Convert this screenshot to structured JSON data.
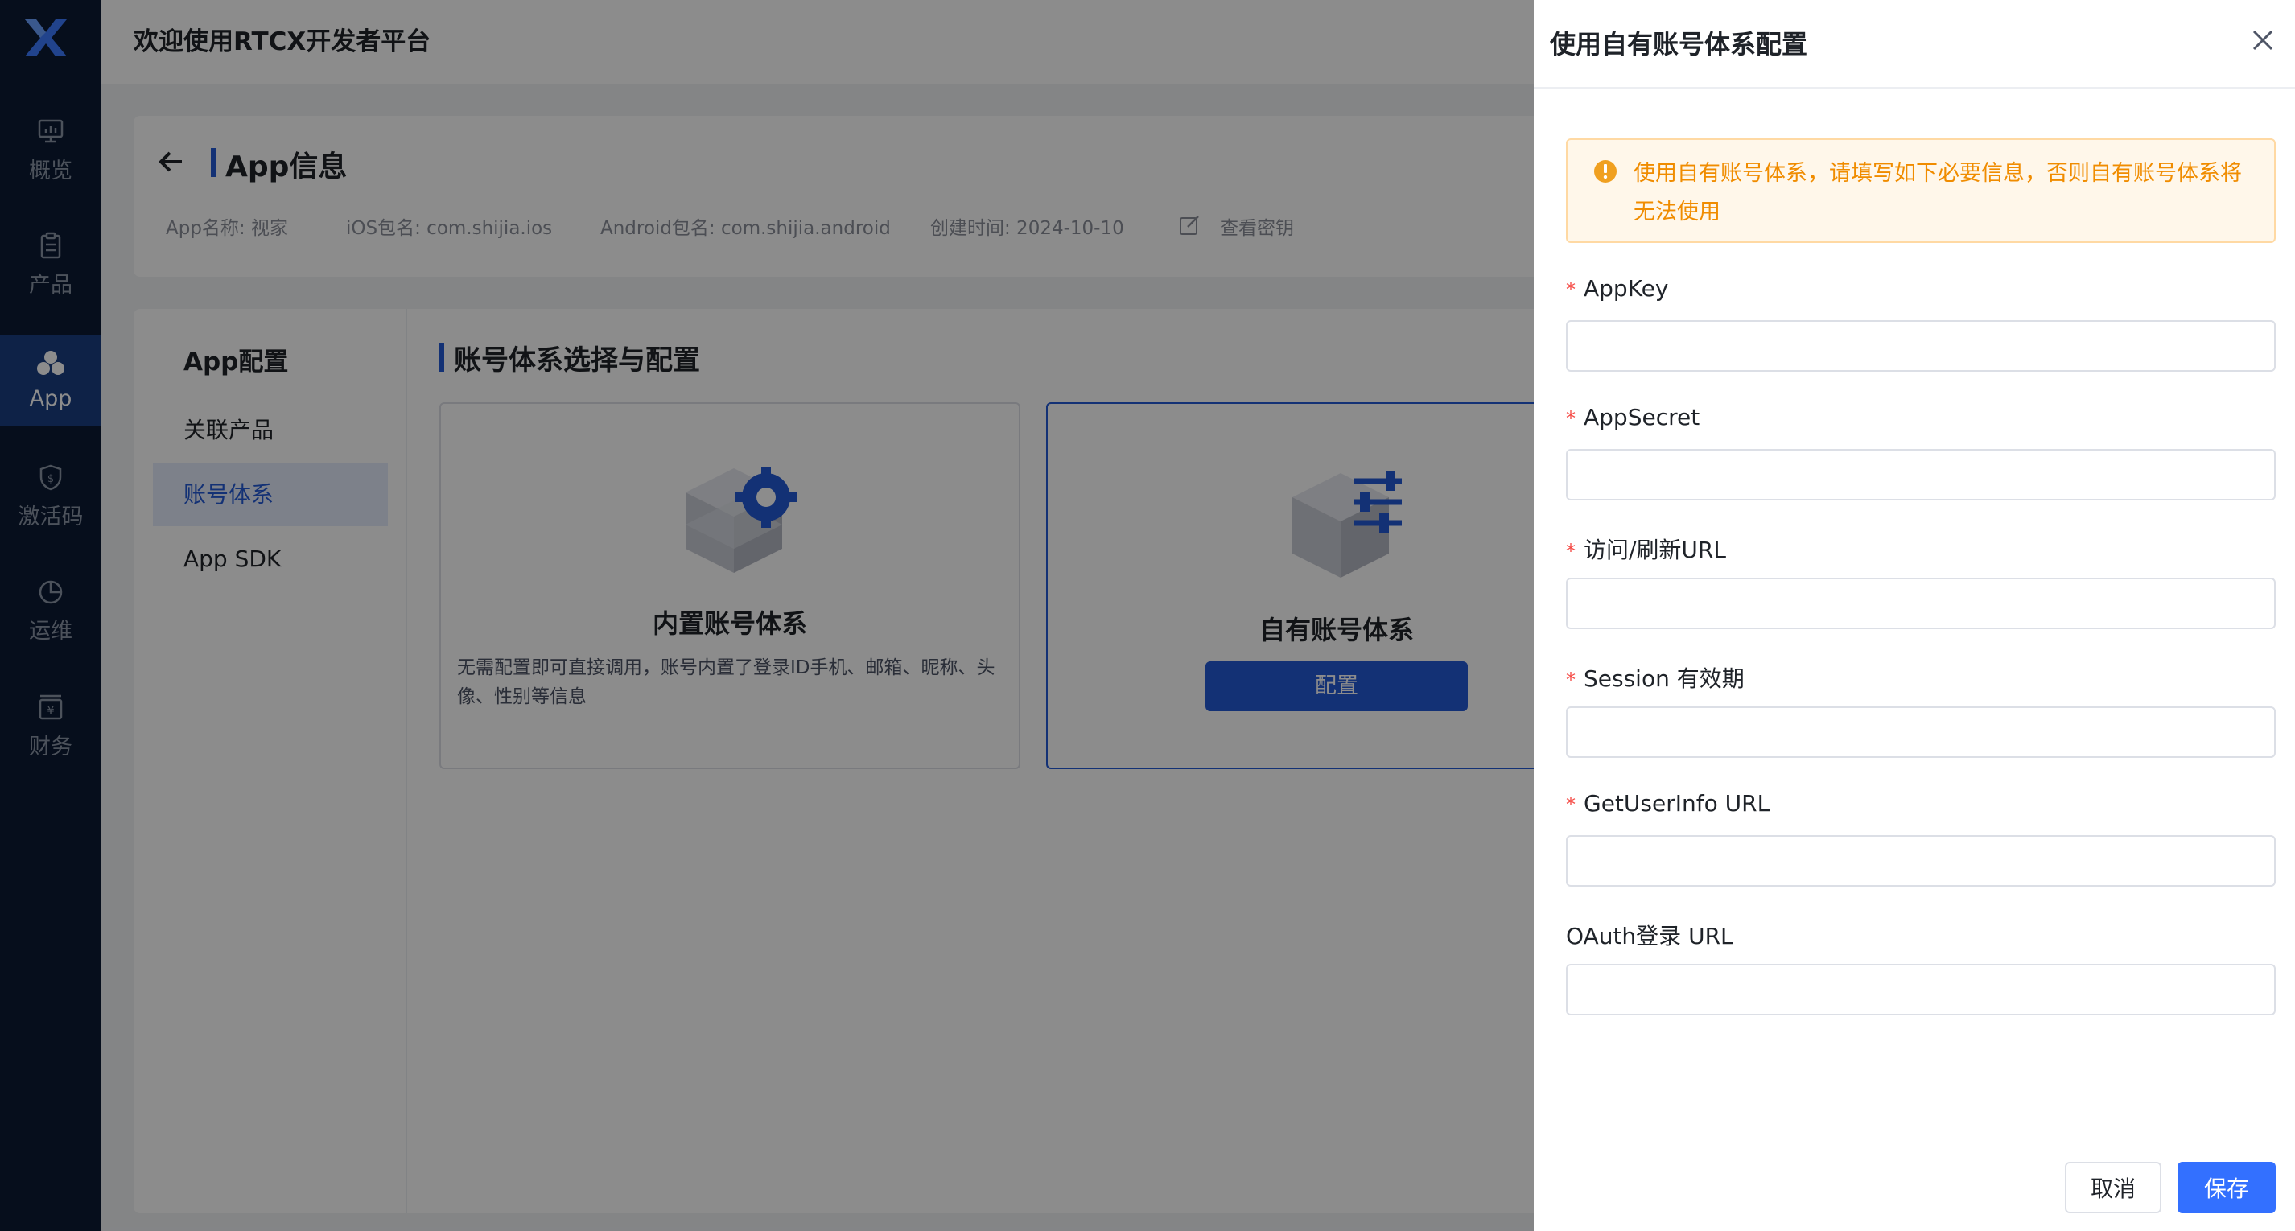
{
  "topbar": {
    "title": "欢迎使用RTCX开发者平台"
  },
  "sidebar": {
    "items": [
      {
        "label": "概览",
        "icon": "monitor-icon"
      },
      {
        "label": "产品",
        "icon": "clipboard-icon"
      },
      {
        "label": "App",
        "icon": "app-cluster-icon",
        "active": true
      },
      {
        "label": "激活码",
        "icon": "shield-icon"
      },
      {
        "label": "运维",
        "icon": "pie-chart-icon"
      },
      {
        "label": "财务",
        "icon": "finance-icon"
      }
    ]
  },
  "app_info": {
    "title": "App信息",
    "meta": [
      "App名称: 视家",
      "iOS包名: com.shijia.ios",
      "Android包名: com.shijia.android",
      "创建时间: 2024-10-10"
    ],
    "view_key_label": "查看密钥"
  },
  "config": {
    "menu_title": "App配置",
    "menu_items": [
      "关联产品",
      "账号体系",
      "App SDK"
    ],
    "section_title": "账号体系选择与配置",
    "options": [
      {
        "title": "内置账号体系",
        "desc": "无需配置即可直接调用，账号内置了登录ID手机、邮箱、昵称、头像、性别等信息"
      },
      {
        "title": "自有账号体系",
        "button": "配置"
      }
    ]
  },
  "drawer": {
    "title": "使用自有账号体系配置",
    "alert": "使用自有账号体系，请填写如下必要信息，否则自有账号体系将无法使用",
    "fields": [
      {
        "label": "AppKey",
        "required": "*",
        "value": ""
      },
      {
        "label": "AppSecret",
        "required": "*",
        "value": ""
      },
      {
        "label": "访问/刷新URL",
        "required": "*",
        "value": ""
      },
      {
        "label": "Session 有效期",
        "required": "*",
        "value": ""
      },
      {
        "label": "GetUserInfo URL",
        "required": "*",
        "value": ""
      },
      {
        "label": "OAuth登录 URL",
        "value": ""
      }
    ],
    "cancel_label": "取消",
    "save_label": "保存"
  },
  "colors": {
    "sidebar_bg": "#0b1a33",
    "sidebar_active": "#1a3e82",
    "accent": "#2459d6",
    "primary_button": "#3370ff",
    "warning_text": "#f08c00",
    "required_mark": "#f54a45"
  }
}
